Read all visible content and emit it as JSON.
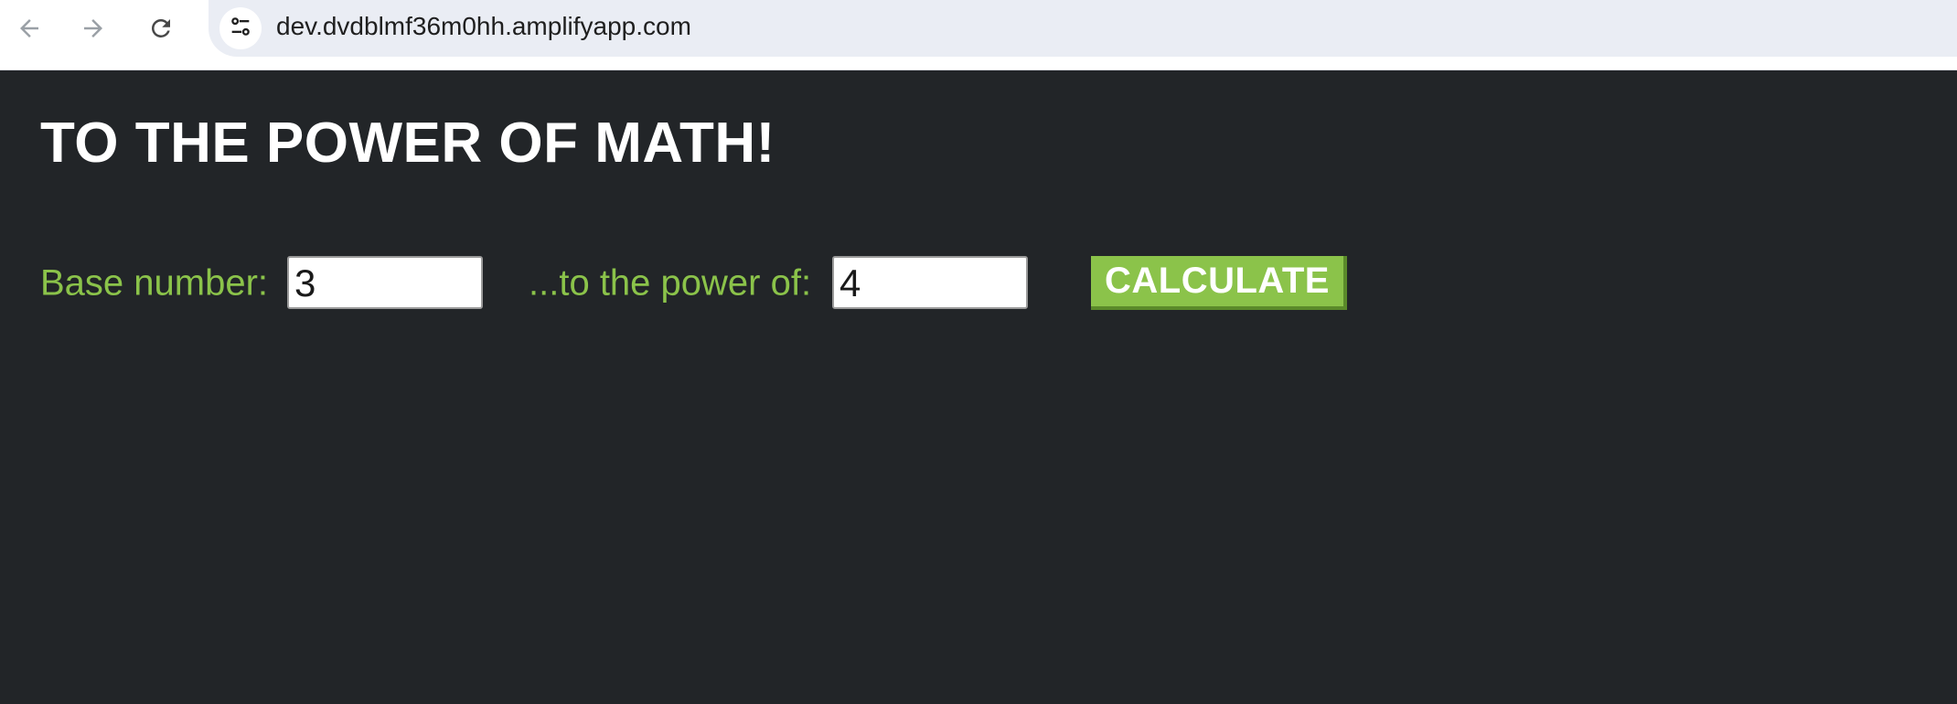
{
  "browser": {
    "url": "dev.dvdblmf36m0hh.amplifyapp.com",
    "icons": {
      "back": "arrow-left-icon",
      "forward": "arrow-right-icon",
      "reload": "reload-icon",
      "site_info": "tune-icon"
    }
  },
  "page": {
    "title": "TO THE POWER OF MATH!",
    "base_label": "Base number:",
    "base_value": "3",
    "power_label": "...to the power of:",
    "power_value": "4",
    "calculate_label": "CALCULATE"
  },
  "colors": {
    "background": "#222528",
    "accent": "#8bc34a",
    "title": "#ffffff"
  }
}
